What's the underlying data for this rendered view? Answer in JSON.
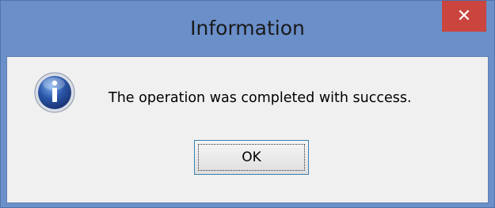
{
  "window": {
    "title": "Information",
    "close_glyph": "✕"
  },
  "dialog": {
    "icon": "info-icon",
    "message": "The operation was completed with success.",
    "ok_label": "OK"
  },
  "colors": {
    "frame": "#6a8fc9",
    "close_button": "#c9453d",
    "client": "#f0f0f0",
    "icon_blue": "#2a56a8"
  }
}
